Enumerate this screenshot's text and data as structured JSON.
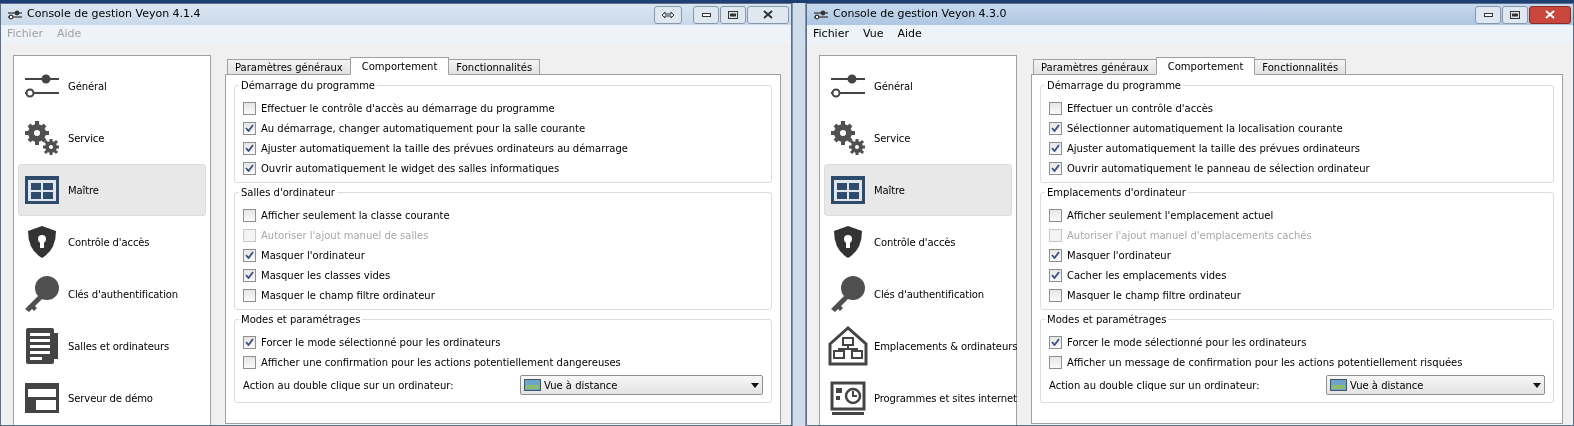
{
  "windows": [
    {
      "title": "Console de gestion Veyon 4.1.4",
      "active": false,
      "title_buttons": [
        {
          "kind": "swap"
        },
        {
          "kind": "minimize"
        },
        {
          "kind": "maximize"
        },
        {
          "kind": "close"
        }
      ],
      "menu": [
        {
          "label": "Fichier",
          "disabled": true
        },
        {
          "label": "Aide",
          "disabled": true
        }
      ],
      "sidebar": [
        {
          "label": "Général",
          "kind": "sliders",
          "selected": false
        },
        {
          "label": "Service",
          "kind": "gears",
          "selected": false
        },
        {
          "label": "Maître",
          "kind": "grid",
          "selected": true
        },
        {
          "label": "Contrôle d'accès",
          "kind": "shield",
          "selected": false
        },
        {
          "label": "Clés d'authentification",
          "kind": "key",
          "selected": false
        },
        {
          "label": "Salles et ordinateurs",
          "kind": "list",
          "selected": false
        },
        {
          "label": "Serveur de démo",
          "kind": "window",
          "selected": false
        }
      ],
      "tabs": [
        {
          "label": "Paramètres généraux",
          "selected": false
        },
        {
          "label": "Comportement",
          "selected": true
        },
        {
          "label": "Fonctionnalités",
          "selected": false
        }
      ],
      "groups": [
        {
          "title": "Démarrage du programme",
          "options": [
            {
              "label": "Effectuer le contrôle d'accès au démarrage du programme",
              "checked": false,
              "disabled": false
            },
            {
              "label": "Au démarrage, changer automatiquement pour la salle courante",
              "checked": true,
              "disabled": false
            },
            {
              "label": "Ajuster automatiquement la taille des prévues ordinateurs au démarrage",
              "checked": true,
              "disabled": false
            },
            {
              "label": "Ouvrir automatiquement le widget des salles informatiques",
              "checked": true,
              "disabled": false
            }
          ]
        },
        {
          "title": "Salles d'ordinateur",
          "options": [
            {
              "label": "Afficher seulement la classe courante",
              "checked": false,
              "disabled": false
            },
            {
              "label": "Autoriser l'ajout manuel de salles",
              "checked": false,
              "disabled": true
            },
            {
              "label": "Masquer l'ordinateur",
              "checked": true,
              "disabled": false
            },
            {
              "label": "Masquer les classes vides",
              "checked": true,
              "disabled": false
            },
            {
              "label": "Masquer le champ filtre ordinateur",
              "checked": false,
              "disabled": false
            }
          ]
        },
        {
          "title": "Modes et paramétrages",
          "options": [
            {
              "label": "Forcer le mode sélectionné pour les ordinateurs",
              "checked": true,
              "disabled": false
            },
            {
              "label": "Afficher une confirmation pour les actions potentiellement dangereuses",
              "checked": false,
              "disabled": false
            }
          ],
          "action": {
            "label": "Action au double clique sur un ordinateur:",
            "value": "Vue à distance"
          }
        }
      ]
    },
    {
      "title": "Console de gestion Veyon 4.3.0",
      "active": true,
      "title_buttons": [
        {
          "kind": "minimize"
        },
        {
          "kind": "maximize"
        },
        {
          "kind": "close"
        }
      ],
      "menu": [
        {
          "label": "Fichier",
          "disabled": false
        },
        {
          "label": "Vue",
          "disabled": false
        },
        {
          "label": "Aide",
          "disabled": false
        }
      ],
      "sidebar": [
        {
          "label": "Général",
          "kind": "sliders",
          "selected": false
        },
        {
          "label": "Service",
          "kind": "gears",
          "selected": false
        },
        {
          "label": "Maître",
          "kind": "grid",
          "selected": true
        },
        {
          "label": "Contrôle d'accès",
          "kind": "shield",
          "selected": false
        },
        {
          "label": "Clés d'authentification",
          "kind": "key",
          "selected": false
        },
        {
          "label": "Emplacements & ordinateurs",
          "kind": "house",
          "selected": false
        },
        {
          "label": "Programmes et sites internet",
          "kind": "programs",
          "selected": false
        }
      ],
      "tabs": [
        {
          "label": "Paramètres généraux",
          "selected": false
        },
        {
          "label": "Comportement",
          "selected": true
        },
        {
          "label": "Fonctionnalités",
          "selected": false
        }
      ],
      "groups": [
        {
          "title": "Démarrage du programme",
          "options": [
            {
              "label": "Effectuer un contrôle d'accès",
              "checked": false,
              "disabled": false
            },
            {
              "label": "Sélectionner automatiquement la localisation courante",
              "checked": true,
              "disabled": false
            },
            {
              "label": "Ajuster automatiquement la taille des prévues ordinateurs",
              "checked": true,
              "disabled": false
            },
            {
              "label": "Ouvrir automatiquement le panneau de sélection ordinateur",
              "checked": true,
              "disabled": false
            }
          ]
        },
        {
          "title": "Emplacements d'ordinateur",
          "options": [
            {
              "label": "Afficher seulement l'emplacement actuel",
              "checked": false,
              "disabled": false
            },
            {
              "label": "Autoriser l'ajout manuel d'emplacements cachés",
              "checked": false,
              "disabled": true
            },
            {
              "label": "Masquer l'ordinateur",
              "checked": true,
              "disabled": false
            },
            {
              "label": "Cacher les emplacements vides",
              "checked": true,
              "disabled": false
            },
            {
              "label": "Masquer le champ filtre ordinateur",
              "checked": false,
              "disabled": false
            }
          ]
        },
        {
          "title": "Modes et paramétrages",
          "options": [
            {
              "label": "Forcer le mode sélectionné pour les ordinateurs",
              "checked": true,
              "disabled": false
            },
            {
              "label": "Afficher un message de confirmation pour les actions potentiellement risquées",
              "checked": false,
              "disabled": false
            }
          ],
          "action": {
            "label": "Action au double clique sur un ordinateur:",
            "value": "Vue à distance"
          }
        }
      ]
    }
  ]
}
